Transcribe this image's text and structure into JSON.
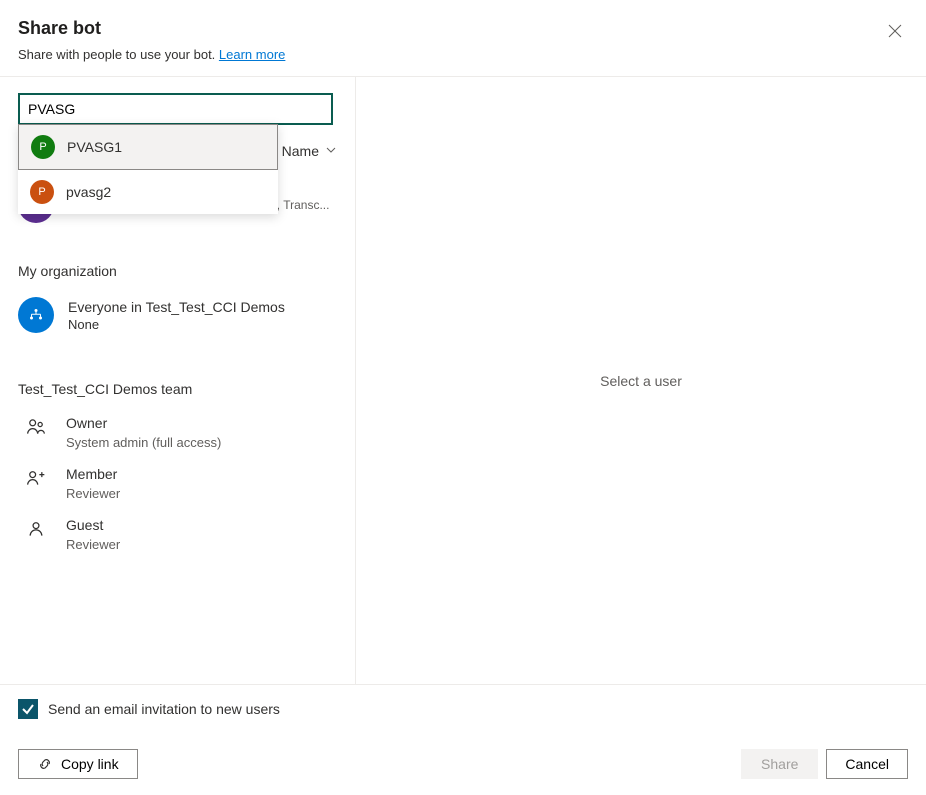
{
  "header": {
    "title": "Share bot",
    "subtitle_prefix": "Share with people to use your bot. ",
    "learn_more": "Learn more"
  },
  "search": {
    "value": "PVASG"
  },
  "dropdown": {
    "items": [
      {
        "name": "PVASG1",
        "initial": "P",
        "avatar_color": "avatar-green",
        "highlighted": true
      },
      {
        "name": "pvasg2",
        "initial": "P",
        "avatar_color": "avatar-orange",
        "highlighted": false
      }
    ]
  },
  "sort": {
    "label": "Name"
  },
  "current_user": {
    "roles": "Owner, Manager, Power Automate user, Transc..."
  },
  "org": {
    "title": "My organization",
    "everyone_label": "Everyone in Test_Test_CCI Demos",
    "permission": "None"
  },
  "team": {
    "title": "Test_Test_CCI Demos team",
    "roles": [
      {
        "name": "Owner",
        "sub": "System admin (full access)",
        "icon": "owner"
      },
      {
        "name": "Member",
        "sub": "Reviewer",
        "icon": "member"
      },
      {
        "name": "Guest",
        "sub": "Reviewer",
        "icon": "guest"
      }
    ]
  },
  "checkbox_label": "Send an email invitation to new users",
  "right_panel": {
    "text": "Select a user"
  },
  "footer": {
    "copy_link": "Copy link",
    "share": "Share",
    "cancel": "Cancel"
  }
}
